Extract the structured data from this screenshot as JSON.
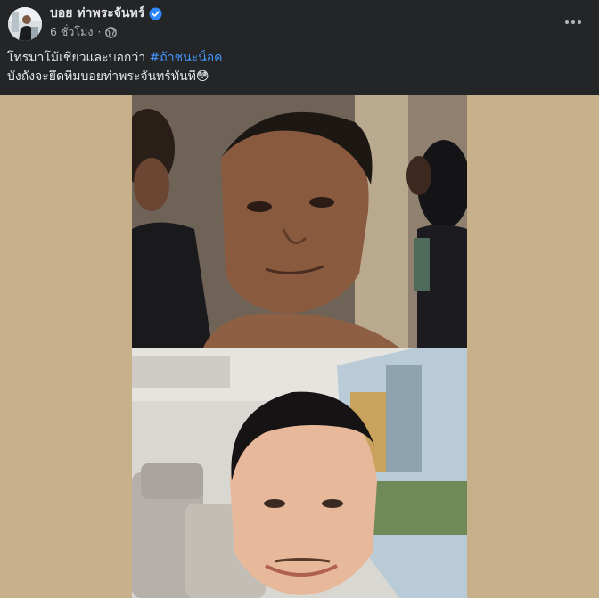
{
  "post": {
    "author": {
      "name": "บอย ท่าพระจันทร์",
      "verified": true,
      "avatar_icon": "profile-avatar"
    },
    "meta": {
      "time": "6 ชั่วโมง",
      "separator": "·",
      "privacy_icon": "globe-icon"
    },
    "more_icon": "more-horizontal-icon",
    "caption": {
      "line1_text": "โทรมาโม้เชียวและบอกว่า ",
      "hashtag": "#ถ้าชนะน็อค",
      "line2_text": "บังถังจะยึดทีมบอยท่าพระจันทร์ทันที😳"
    }
  },
  "media": {
    "background_color": "#c8b08b",
    "frames": [
      {
        "name": "top-video-frame",
        "description_icon": "video-call-frame"
      },
      {
        "name": "bottom-video-frame",
        "description_icon": "video-call-frame"
      }
    ]
  },
  "colors": {
    "background": "#242526",
    "text_primary": "#e4e6eb",
    "text_secondary": "#b0b3b8",
    "link": "#4599ff",
    "verified": "#2d88ff"
  }
}
